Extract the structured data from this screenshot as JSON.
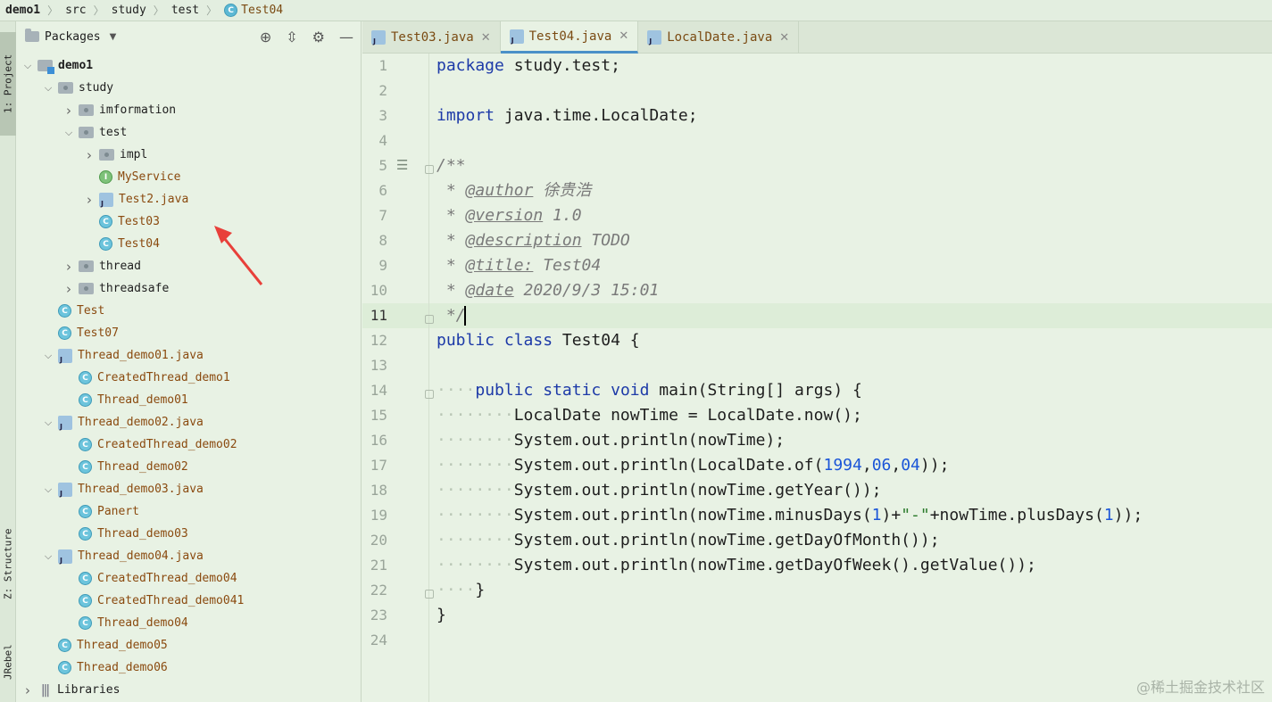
{
  "breadcrumb": [
    "demo1",
    "src",
    "study",
    "test",
    "Test04"
  ],
  "breadcrumb_icon": "class-icon",
  "side_tabs": {
    "project": "1: Project",
    "structure": "Z: Structure",
    "jrebel": "JRebel"
  },
  "project_panel": {
    "title": "Packages",
    "header_icons": [
      "locate-icon",
      "collapse-all-icon",
      "gear-icon",
      "minimize-icon"
    ]
  },
  "tree": [
    {
      "label": "demo1",
      "icon": "module",
      "arrow": "open"
    },
    {
      "label": "study",
      "icon": "folder",
      "arrow": "open"
    },
    {
      "label": "imformation",
      "icon": "folder",
      "arrow": "closed"
    },
    {
      "label": "test",
      "icon": "folder",
      "arrow": "open"
    },
    {
      "label": "impl",
      "icon": "folder",
      "arrow": "closed"
    },
    {
      "label": "MyService",
      "icon": "interface",
      "arrow": "none"
    },
    {
      "label": "Test2.java",
      "icon": "java",
      "arrow": "closed"
    },
    {
      "label": "Test03",
      "icon": "class",
      "arrow": "none"
    },
    {
      "label": "Test04",
      "icon": "class",
      "arrow": "none"
    },
    {
      "label": "thread",
      "icon": "folder",
      "arrow": "closed"
    },
    {
      "label": "threadsafe",
      "icon": "folder",
      "arrow": "closed"
    },
    {
      "label": "Test",
      "icon": "class",
      "arrow": "none"
    },
    {
      "label": "Test07",
      "icon": "class",
      "arrow": "none"
    },
    {
      "label": "Thread_demo01.java",
      "icon": "java",
      "arrow": "open"
    },
    {
      "label": "CreatedThread_demo1",
      "icon": "class",
      "arrow": "none"
    },
    {
      "label": "Thread_demo01",
      "icon": "class",
      "arrow": "none"
    },
    {
      "label": "Thread_demo02.java",
      "icon": "java",
      "arrow": "open"
    },
    {
      "label": "CreatedThread_demo02",
      "icon": "class",
      "arrow": "none"
    },
    {
      "label": "Thread_demo02",
      "icon": "class",
      "arrow": "none"
    },
    {
      "label": "Thread_demo03.java",
      "icon": "java",
      "arrow": "open"
    },
    {
      "label": "Panert",
      "icon": "class",
      "arrow": "none"
    },
    {
      "label": "Thread_demo03",
      "icon": "class",
      "arrow": "none"
    },
    {
      "label": "Thread_demo04.java",
      "icon": "java",
      "arrow": "open"
    },
    {
      "label": "CreatedThread_demo04",
      "icon": "class",
      "arrow": "none"
    },
    {
      "label": "CreatedThread_demo041",
      "icon": "class",
      "arrow": "none"
    },
    {
      "label": "Thread_demo04",
      "icon": "class",
      "arrow": "none"
    },
    {
      "label": "Thread_demo05",
      "icon": "class",
      "arrow": "none"
    },
    {
      "label": "Thread_demo06",
      "icon": "class",
      "arrow": "none"
    },
    {
      "label": "Libraries",
      "icon": "libraries",
      "arrow": "closed"
    }
  ],
  "tabs": [
    {
      "label": "Test03.java",
      "active": false
    },
    {
      "label": "Test04.java",
      "active": true
    },
    {
      "label": "LocalDate.java",
      "active": false
    }
  ],
  "editor": {
    "line_numbers": [
      "1",
      "2",
      "3",
      "4",
      "5",
      "6",
      "7",
      "8",
      "9",
      "10",
      "11",
      "12",
      "13",
      "14",
      "15",
      "16",
      "17",
      "18",
      "19",
      "20",
      "21",
      "22",
      "23",
      "24"
    ],
    "current_line": "11",
    "code": {
      "l1_kw": "package",
      "l1_rest": " study.test;",
      "l3_kw": "import",
      "l3_rest": " java.time.LocalDate;",
      "l5": "/**",
      "l6_star": " * ",
      "l6_tag": "@author",
      "l6_val": " 徐贵浩",
      "l7_tag": "@version",
      "l7_val": " 1.0",
      "l8_tag": "@description",
      "l8_val": " TODO",
      "l9_tag": "@title:",
      "l9_val": " Test04",
      "l10_tag": "@date",
      "l10_val": " 2020/9/3 15:01",
      "l11": " */",
      "l12_kw1": "public",
      "l12_kw2": "class",
      "l12_rest": " Test04 {",
      "l14_kw1": "public",
      "l14_kw2": "static",
      "l14_kw3": "void",
      "l14_rest": " main(String[] args) {",
      "l15": "LocalDate nowTime = LocalDate.now();",
      "l16": "System.out.println(nowTime);",
      "l17_a": "System.out.println(LocalDate.of(",
      "l17_n1": "1994",
      "l17_n2": "06",
      "l17_n3": "04",
      "l17_b": "));",
      "l18": "System.out.println(nowTime.getYear());",
      "l19_a": "System.out.println(nowTime.minusDays(",
      "l19_n1": "1",
      "l19_b": ")+",
      "l19_s": "\"-\"",
      "l19_c": "+nowTime.plusDays(",
      "l19_n2": "1",
      "l19_d": "));",
      "l20": "System.out.println(nowTime.getDayOfMonth());",
      "l21": "System.out.println(nowTime.getDayOfWeek().getValue());",
      "l22": "}",
      "l23": "}"
    }
  },
  "watermark": "@稀土掘金技术社区",
  "colors": {
    "background": "#e8f2e4",
    "keyword": "#1d3aa8",
    "number": "#1a55d8",
    "string": "#2a7a2a",
    "annotation_arrow": "#e8403a"
  }
}
